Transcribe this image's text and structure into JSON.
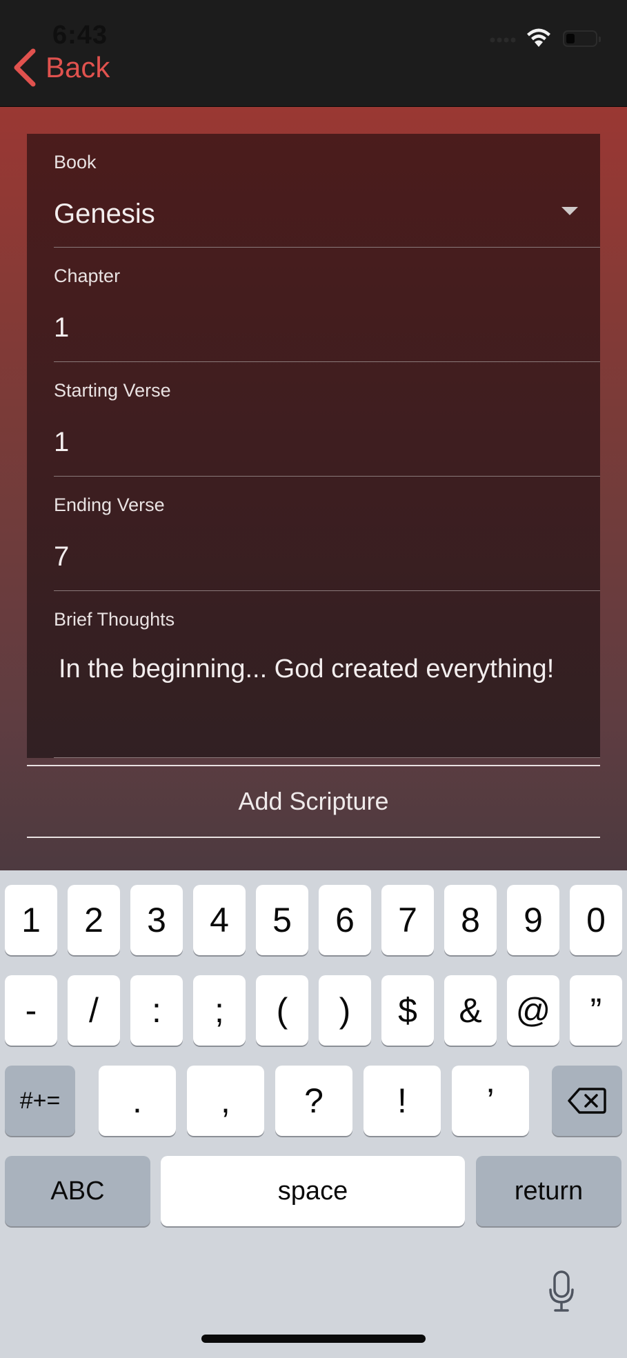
{
  "status_bar": {
    "time": "6:43"
  },
  "nav": {
    "back_label": "Back"
  },
  "form": {
    "book": {
      "label": "Book",
      "value": "Genesis"
    },
    "chapter": {
      "label": "Chapter",
      "value": "1"
    },
    "starting_verse": {
      "label": "Starting Verse",
      "value": "1"
    },
    "ending_verse": {
      "label": "Ending Verse",
      "value": "7"
    },
    "brief_thoughts": {
      "label": "Brief Thoughts",
      "value": "In the beginning... God created everything!"
    },
    "submit_label": "Add Scripture"
  },
  "keyboard": {
    "row1": [
      "1",
      "2",
      "3",
      "4",
      "5",
      "6",
      "7",
      "8",
      "9",
      "0"
    ],
    "row2": [
      "-",
      "/",
      ":",
      ";",
      "(",
      ")",
      "$",
      "&",
      "@",
      "”"
    ],
    "row3": [
      ".",
      ",",
      "?",
      "!",
      "’"
    ],
    "symbols_label": "#+=",
    "abc_label": "ABC",
    "space_label": "space",
    "return_label": "return",
    "delete_icon": "backspace-icon",
    "mic_icon": "microphone-icon"
  },
  "colors": {
    "accent": "#e0524e",
    "gradient_top": "#9a3833",
    "gradient_bottom": "#4d3a40",
    "card_top": "#4b1c1c",
    "keyboard_bg": "#d1d5db"
  }
}
